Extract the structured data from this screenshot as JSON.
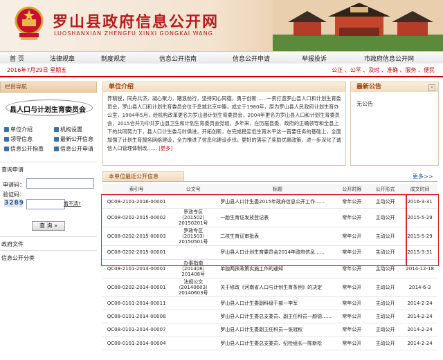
{
  "header": {
    "title": "罗山县政府信息公开网",
    "subtitle": "LUOSHANXIAN ZHENGFU XINXI GONGKAI WANG"
  },
  "nav": [
    "首 页",
    "法律规章",
    "制度规定",
    "信息公开指南",
    "信息公开申请",
    "举报投诉",
    "市政府信息公开网"
  ],
  "datebar": {
    "date": "2016年7月29日 星期五",
    "motto": "公正 、公平 、及时 、准确 、服务 、便民"
  },
  "left": {
    "header": "栏目导航",
    "unit_name": "县人口与计划生育委员会",
    "links": [
      "单位介绍",
      "机构设置",
      "领导信息",
      "最新公开信息",
      "信息公开指南",
      "信息公开申请"
    ],
    "query_title": "查询申请",
    "apply_code_label": "申请码：",
    "verify_label": "验证码：",
    "captcha": "3289",
    "not_clear": "看不清?",
    "query_button": "查 询",
    "gov_docs": "政府文件",
    "info_class": "信息公开分类"
  },
  "intro": {
    "title": "单位介绍",
    "text": "养精锐，同舟共济，凝心聚力，踏浪前行，坚持同心同德，勇于创新……一贯打造罗山县人口和计划生育委员会，罗山县人口和计划生育委员会位于息城北京中路，成立于1980年，原为罗山县人民政府计划生育办公室，1984年5月，经机构改革更名为罗山县计划生育委员会，2004年更名为罗山县人口和计划生育委员会，2015合并为中共罗山县卫生和计划生育委员会党组，多年来，在历届县委、政府的正确领导和全县上下的共同努力下，县人口计生委与时俱进，开拓创新，在完成稳定低生育水平这一首要任务的基础上，全面加强了计划生育服务网络建设，全力推进了信息化建设步伐，更好的落实了奖励优惠政策，进一步深化了诚信人口管理体制改……",
    "more": "[更多]"
  },
  "notice": {
    "title": "最新公告",
    "content": "无公告"
  },
  "table": {
    "tab": "本单位最近公开信息",
    "more": "更多>>",
    "headers": [
      "索引号",
      "公文号",
      "标题",
      "公开时限",
      "公开形式",
      "成文时间"
    ],
    "rows": [
      [
        "QC08-2101-2016-00001",
        "",
        "罗山县人口计生委2015年政府信息公开工作……",
        "常年公开",
        "主动公开",
        "2016-3-31"
      ],
      [
        "QC08-0202-2015-00002",
        "",
        "一胎生育证发放登记表",
        "常年公开",
        "主动公开",
        "2015-5-29"
      ],
      [
        "QC08-0202-2015-00003",
        "",
        "二孩生育证审批表",
        "常年公开",
        "主动公开",
        "2015-5-29"
      ],
      [
        "QC08-0202-2015-00001",
        "",
        "罗山县人口计划生育委员会2014年政府信息……",
        "常年公开",
        "主动公开",
        "2015-3-31"
      ],
      [
        "QC08-2101-2014-00001",
        "",
        "单独两孩政策实施工作的通知",
        "常年公开",
        "主动公开",
        "2014-12-18"
      ],
      [
        "QC08-0202-2014-00001",
        "",
        "关于修改《河南省人口与计划生育条例》的决定",
        "常年公开",
        "主动公开",
        "2014-6-3"
      ],
      [
        "QC08-0101-2014-00011",
        "",
        "罗山县人口计生委副科级干部一李军",
        "常年公开",
        "主动公开",
        "2014-2-24"
      ],
      [
        "QC08-0101-2014-00008",
        "",
        "罗山县人口计生委总支委员、副主任科员一颜德……",
        "常年公开",
        "主动公开",
        "2014-2-24"
      ],
      [
        "QC08-0101-2014-00007",
        "",
        "罗山县人口计生委副主任科员一张冠权",
        "常年公开",
        "主动公开",
        "2014-2-24"
      ],
      [
        "QC08-0101-2014-00004",
        "",
        "罗山县人口计生委总支委员、纪检组长一陈新松",
        "常年公开",
        "主动公开",
        "2014-2-24"
      ]
    ],
    "doc_numbers": [
      "罗政专区（201502）20150201号",
      "罗政专区（201503）20150501号",
      "办事指南（201408）201408号",
      "法规公文（20140603）20140603号"
    ]
  },
  "colors": {
    "accent": "#c00000",
    "title_red": "#b71c1c",
    "link_blue": "#2a4f8a"
  }
}
